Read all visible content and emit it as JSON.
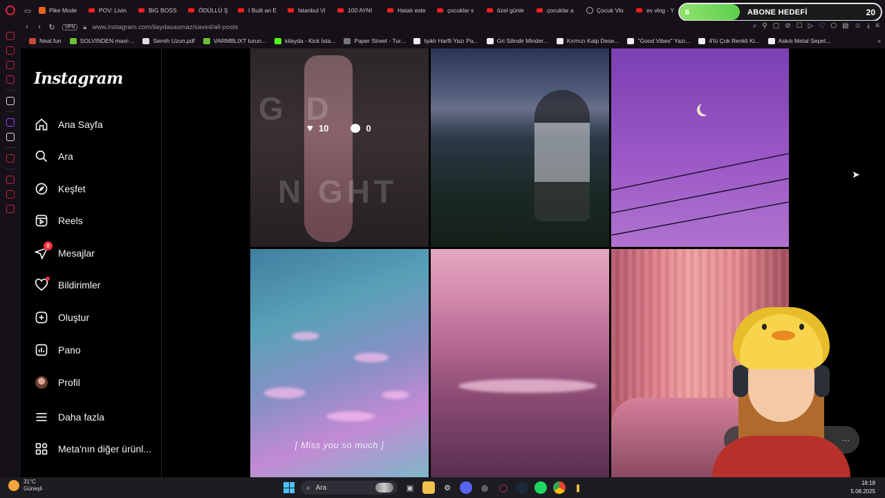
{
  "browser": {
    "tabs": [
      {
        "icon": "hb",
        "title": "Pike Mode"
      },
      {
        "icon": "yt",
        "title": "POV: Livin"
      },
      {
        "icon": "yt",
        "title": "BIG BOSS"
      },
      {
        "icon": "yt",
        "title": "ÖDÜLLÜ Ş"
      },
      {
        "icon": "yt",
        "title": "I Built an E"
      },
      {
        "icon": "yt",
        "title": "İstanbul Vi"
      },
      {
        "icon": "yt",
        "title": "100 AYNI"
      },
      {
        "icon": "yt",
        "title": "Hatalı este"
      },
      {
        "icon": "yt",
        "title": "çocuklar s"
      },
      {
        "icon": "yt",
        "title": "özel günle"
      },
      {
        "icon": "yt",
        "title": "çocuklar a"
      },
      {
        "icon": "globe",
        "title": "Çocuk Vlo"
      },
      {
        "icon": "yt",
        "title": "ev vlog - Y"
      }
    ],
    "vpn_label": "VPN",
    "url": "www.instagram.com/ilaydasasmaz/saved/all-posts",
    "bookmarks": [
      {
        "label": "Neal.fun",
        "color": "#c74a3a"
      },
      {
        "label": "SOLVINDEN mavi-...",
        "color": "#6bbf3a"
      },
      {
        "label": "Semih Uzun.pdf",
        "color": "#dddddd"
      },
      {
        "label": "VARMBLIXT turun...",
        "color": "#6bbf3a"
      },
      {
        "label": "kilayda - Kick İsta...",
        "color": "#53fc18"
      },
      {
        "label": "Paper Street - Tur...",
        "color": "#777777"
      },
      {
        "label": "Işıklı Harfli Yazı Pa...",
        "color": "#eeeeee"
      },
      {
        "label": "Gri Silindir Minder...",
        "color": "#eeeeee"
      },
      {
        "label": "Kırmızı Kalp Dese...",
        "color": "#eeeeee"
      },
      {
        "label": "\"Good Vibes\" Yazı...",
        "color": "#eeeeee"
      },
      {
        "label": "4'lü Çok Renkli Ki...",
        "color": "#eeeeee"
      },
      {
        "label": "Askılı Metal Sepet...",
        "color": "#eeeeee"
      }
    ]
  },
  "overlay_goal": {
    "current": "6",
    "label": "ABONE HEDEFİ",
    "target": "20",
    "fill_fraction": 0.3
  },
  "instagram": {
    "logo": "Instagram",
    "nav": [
      {
        "name": "home",
        "label": "Ana Sayfa"
      },
      {
        "name": "search",
        "label": "Ara"
      },
      {
        "name": "explore",
        "label": "Keşfet"
      },
      {
        "name": "reels",
        "label": "Reels"
      },
      {
        "name": "messages",
        "label": "Mesajlar",
        "badge": "8"
      },
      {
        "name": "notifications",
        "label": "Bildirimler"
      },
      {
        "name": "create",
        "label": "Oluştur"
      },
      {
        "name": "dashboard",
        "label": "Pano"
      },
      {
        "name": "profile",
        "label": "Profil"
      },
      {
        "name": "more",
        "label": "Daha fazla"
      },
      {
        "name": "meta",
        "label": "Meta'nın diğer ürünl..."
      }
    ],
    "posts": [
      {
        "likes": "10",
        "comments": "0",
        "overlay_text_1": "G   D",
        "overlay_text_2": "N GHT"
      },
      {},
      {},
      {
        "caption": "[ Miss you so much ]"
      },
      {},
      {}
    ]
  },
  "taskbar": {
    "weather_temp": "31°C",
    "weather_desc": "Güneşli",
    "search_placeholder": "Ara",
    "time": "18:18",
    "date": "5.08.2025"
  }
}
